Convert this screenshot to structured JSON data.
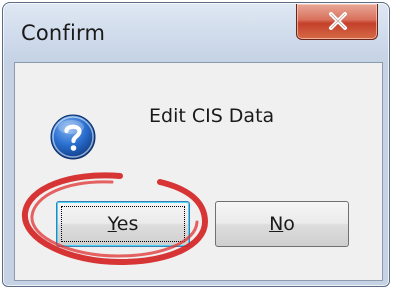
{
  "window": {
    "title": "Confirm"
  },
  "dialog": {
    "message": "Edit CIS Data",
    "icon": "question-icon"
  },
  "buttons": {
    "yes": {
      "mnemonic": "Y",
      "rest": "es"
    },
    "no": {
      "mnemonic": "N",
      "rest": "o"
    }
  },
  "annotation": {
    "color": "#d42020",
    "target": "yes-button"
  },
  "colors": {
    "close_button": "#c4412a",
    "focus_border": "#3c7fb1",
    "icon_blue": "#1f5fb8"
  }
}
